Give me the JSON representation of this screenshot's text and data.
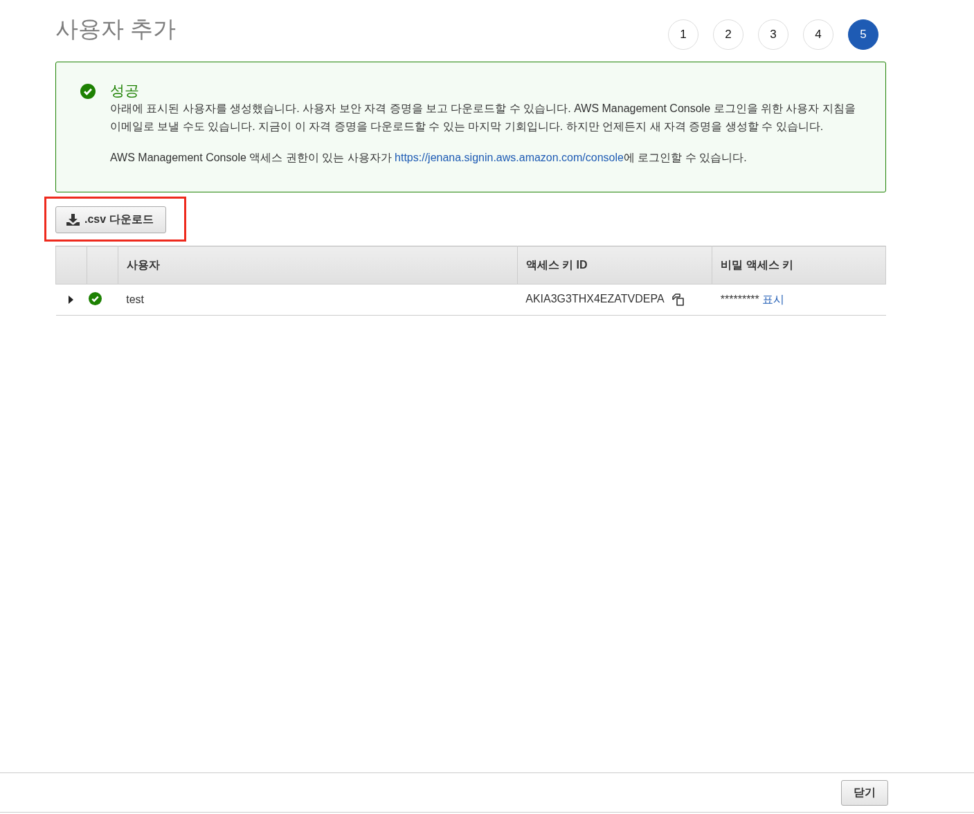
{
  "page": {
    "title": "사용자 추가"
  },
  "steps": [
    {
      "label": "1",
      "selected": false
    },
    {
      "label": "2",
      "selected": false
    },
    {
      "label": "3",
      "selected": false
    },
    {
      "label": "4",
      "selected": false
    },
    {
      "label": "5",
      "selected": true
    }
  ],
  "alert": {
    "kind": "success",
    "title": "성공",
    "message": "아래에 표시된 사용자를 생성했습니다. 사용자 보안 자격 증명을 보고 다운로드할 수 있습니다. AWS Management Console 로그인을 위한 사용자 지침을 이메일로 보낼 수도 있습니다. 지금이 이 자격 증명을 다운로드할 수 있는 마지막 기회입니다. 하지만 언제든지 새 자격 증명을 생성할 수 있습니다.",
    "console_note": {
      "before": "AWS Management Console 액세스 권한이 있는 사용자가 ",
      "link": "https://jenana.signin.aws.amazon.com/console",
      "after": "에 로그인할 수 있습니다."
    }
  },
  "download_button": {
    "label": ".csv 다운로드",
    "highlighted": true
  },
  "table": {
    "columns": [
      "사용자",
      "액세스 키 ID",
      "비밀 액세스 키"
    ],
    "rows": [
      {
        "expanded": false,
        "succeeded": true,
        "user": "test",
        "access_key_id": "AKIA3G3THX4EZATVDEPA",
        "secret_mask": "*********",
        "show_link": "표시"
      }
    ]
  },
  "footer": {
    "close_button": "닫기"
  }
}
